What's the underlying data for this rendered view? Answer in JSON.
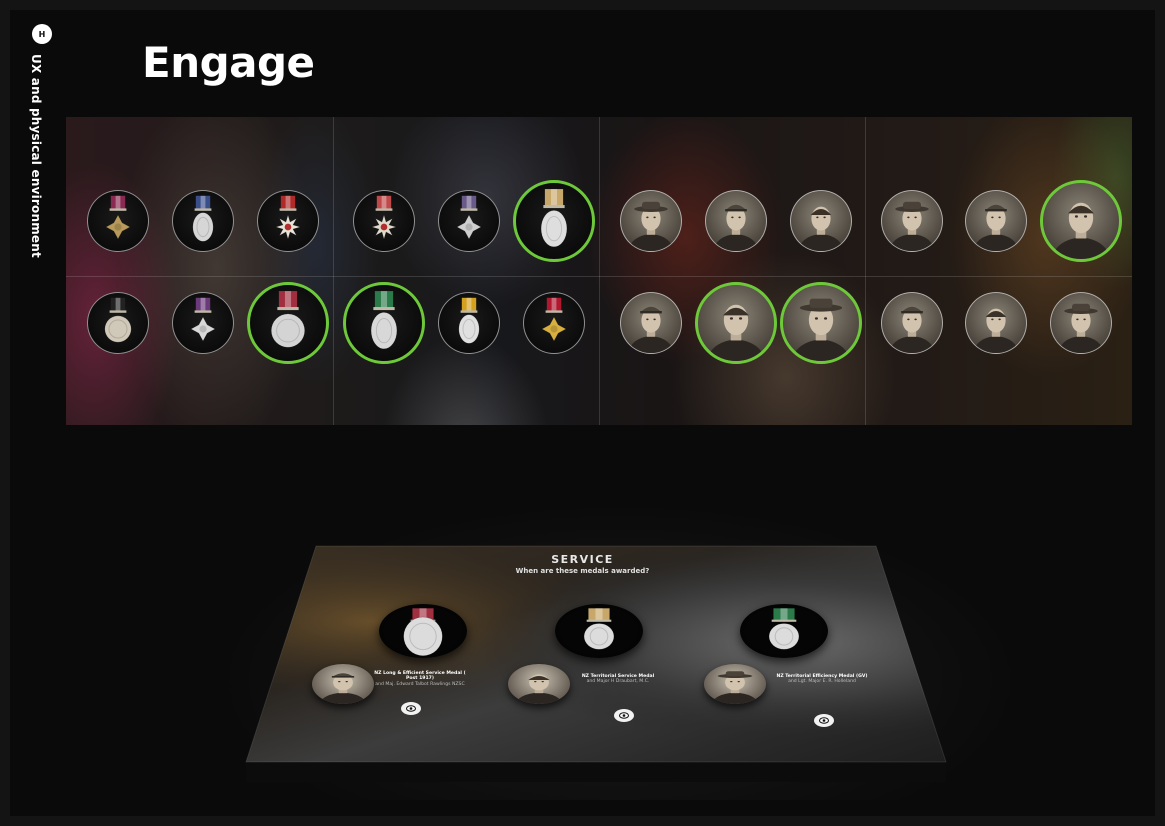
{
  "sidebar": {
    "badge": "H",
    "section_label": "UX and physical environment"
  },
  "page": {
    "title": "Engage"
  },
  "wall": {
    "row1_medals": [
      {
        "name": "victoria-cross-medal-icon",
        "ribbon": "#8a2a52",
        "metal": "#b89a5a",
        "shape": "cross",
        "selected": false
      },
      {
        "name": "distinguished-conduct-medal-icon",
        "ribbon": "#3a4e8a",
        "metal": "#d6d6d6",
        "shape": "oval",
        "selected": false
      },
      {
        "name": "order-star-medal-icon",
        "ribbon": "#b02a2a",
        "metal": "#e9e4d8",
        "shape": "star",
        "selected": false
      },
      {
        "name": "order-badge-medal-icon",
        "ribbon": "#c04a4a",
        "metal": "#e0dccd",
        "shape": "star",
        "selected": false
      },
      {
        "name": "flying-cross-medal-icon",
        "ribbon": "#6a5a8a",
        "metal": "#cfcfcf",
        "shape": "cross",
        "selected": false
      },
      {
        "name": "nz-territorial-service-medal-icon",
        "ribbon": "#c8a86a",
        "metal": "#dedede",
        "shape": "oval",
        "selected": true
      }
    ],
    "row1_portraits": [
      {
        "name": "portrait-elderly-man-icon",
        "selected": false
      },
      {
        "name": "portrait-soldier-camera-icon",
        "selected": false
      },
      {
        "name": "portrait-officer-painted-icon",
        "selected": false
      },
      {
        "name": "portrait-officer-cap-icon",
        "selected": false
      },
      {
        "name": "portrait-airman-icon",
        "selected": false
      },
      {
        "name": "portrait-slouch-hat-soldier-icon",
        "selected": true
      }
    ],
    "row2_medals": [
      {
        "name": "round-silver-medal-icon",
        "ribbon": "#222222",
        "metal": "#d0c8b8",
        "shape": "round",
        "selected": false
      },
      {
        "name": "military-cross-medal-icon",
        "ribbon": "#6a3a7a",
        "metal": "#d8d8d8",
        "shape": "cross",
        "selected": false
      },
      {
        "name": "nz-long-efficient-service-medal-icon",
        "ribbon": "#a03040",
        "metal": "#d4d4d4",
        "shape": "round",
        "selected": true
      },
      {
        "name": "nz-territorial-efficiency-medal-icon",
        "ribbon": "#2a7a4a",
        "metal": "#d8d8d8",
        "shape": "oval",
        "selected": true
      },
      {
        "name": "gold-ribbon-oval-medal-icon",
        "ribbon": "#d4a020",
        "metal": "#e0e0e0",
        "shape": "oval",
        "selected": false
      },
      {
        "name": "obe-order-medal-icon",
        "ribbon": "#b01830",
        "metal": "#d8b040",
        "shape": "cross",
        "selected": false
      }
    ],
    "row2_portraits": [
      {
        "name": "portrait-group-crowd-icon",
        "selected": false
      },
      {
        "name": "portrait-smiling-man-icon",
        "selected": true
      },
      {
        "name": "portrait-peaked-cap-soldier-icon",
        "selected": true
      },
      {
        "name": "portrait-landscape-scene-icon",
        "selected": false
      },
      {
        "name": "portrait-uniformed-man-icon",
        "selected": false
      },
      {
        "name": "portrait-woman-icon",
        "selected": false
      }
    ]
  },
  "table": {
    "title": "SERVICE",
    "question": "When are these medals awarded?",
    "entries": [
      {
        "medal_name": "nz-long-efficient-service-medal-icon",
        "ribbon": "#a03040",
        "medal_title": "NZ Long & Efficient Service Medal ( Post 1917)",
        "recipients": "and Maj. Edward Talbot Rawlings NZSC"
      },
      {
        "medal_name": "nz-territorial-service-medal-icon",
        "ribbon": "#c8a86a",
        "medal_title": "NZ Territorial Service Medal",
        "recipients": "and Major H Draubart, M.C."
      },
      {
        "medal_name": "nz-territorial-efficiency-medal-icon",
        "ribbon": "#2a7a4a",
        "medal_title": "NZ Territorial Efficiency Medal (GV)",
        "recipients": "and Lgt. Major E. R. Holleland"
      }
    ]
  }
}
